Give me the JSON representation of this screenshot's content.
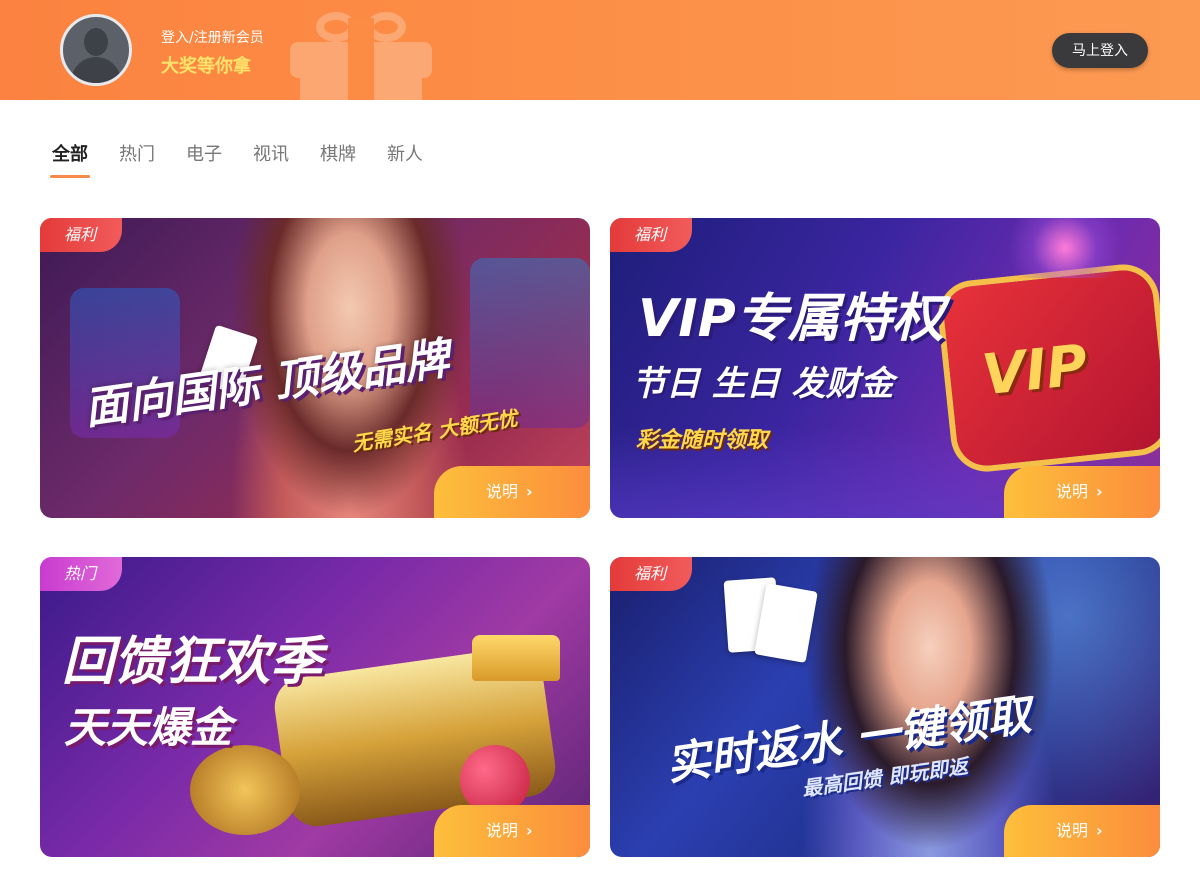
{
  "header": {
    "subtitle": "登入/注册新会员",
    "title": "大奖等你拿",
    "login_button": "马上登入"
  },
  "tabs": [
    {
      "label": "全部",
      "active": true
    },
    {
      "label": "热门",
      "active": false
    },
    {
      "label": "电子",
      "active": false
    },
    {
      "label": "视讯",
      "active": false
    },
    {
      "label": "棋牌",
      "active": false
    },
    {
      "label": "新人",
      "active": false
    }
  ],
  "cards": [
    {
      "tag": "福利",
      "headline": "面向国际 顶级品牌",
      "subline": "无需实名 大额无忧",
      "button": "说明"
    },
    {
      "tag": "福利",
      "headline": "VIP专属特权",
      "subline": "节日 生日 发财金",
      "extra": "彩金随时领取",
      "badge": "VIP",
      "button": "说明"
    },
    {
      "tag": "热门",
      "headline": "回馈狂欢季",
      "subline": "天天爆金",
      "button": "说明"
    },
    {
      "tag": "福利",
      "headline": "实时返水 一键领取",
      "subline": "最高回馈 即玩即返",
      "button": "说明"
    }
  ],
  "colors": {
    "header_orange": "#fc8e46",
    "accent_yellow": "#ffe36a",
    "tab_underline": "#f7894a",
    "tag_red": "#e43a3a",
    "button_dark": "#3a3a3c"
  }
}
